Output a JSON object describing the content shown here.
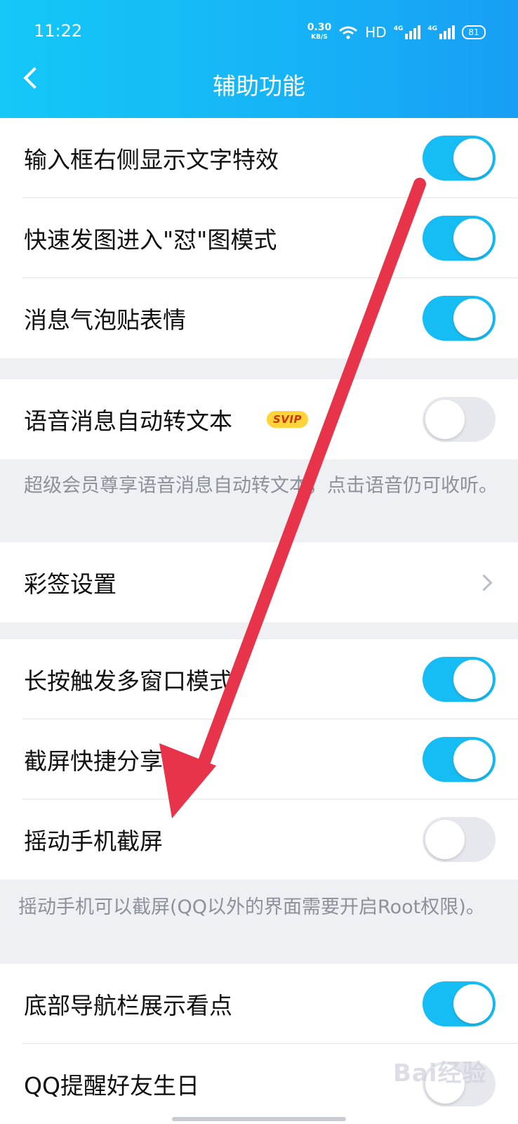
{
  "status_bar": {
    "time": "11:22",
    "net_speed": "0.30",
    "net_speed_unit": "KB/S",
    "hd": "HD",
    "signal1": "4G",
    "signal2": "4G",
    "battery": "81"
  },
  "header": {
    "title": "辅助功能"
  },
  "settings": {
    "text_effect": {
      "label": "输入框右侧显示文字特效",
      "on": true
    },
    "quick_image": {
      "label": "快速发图进入\"怼\"图模式",
      "on": true
    },
    "bubble_sticker": {
      "label": "消息气泡贴表情",
      "on": true
    },
    "voice_to_text": {
      "label": "语音消息自动转文本",
      "badge": "SVIP",
      "on": false
    },
    "voice_note": "超级会员尊享语音消息自动转文本，点击语音仍可收听。",
    "color_sign": {
      "label": "彩签设置"
    },
    "multi_window": {
      "label": "长按触发多窗口模式",
      "on": true
    },
    "screenshot_share": {
      "label": "截屏快捷分享",
      "on": true
    },
    "shake_screenshot": {
      "label": "摇动手机截屏",
      "on": false
    },
    "shake_note": "摇动手机可以截屏(QQ以外的界面需要开启Root权限)。",
    "nav_kandian": {
      "label": "底部导航栏展示看点",
      "on": true
    },
    "birthday": {
      "label": "QQ提醒好友生日",
      "on": false
    }
  },
  "watermark": "Bai经验",
  "colors": {
    "header_start": "#14c8f7",
    "header_end": "#189ef4",
    "toggle_on": "#16bdf5",
    "toggle_off": "#e6e8ee",
    "arrow": "#e8344a",
    "badge_bg": "#ffd43b"
  }
}
